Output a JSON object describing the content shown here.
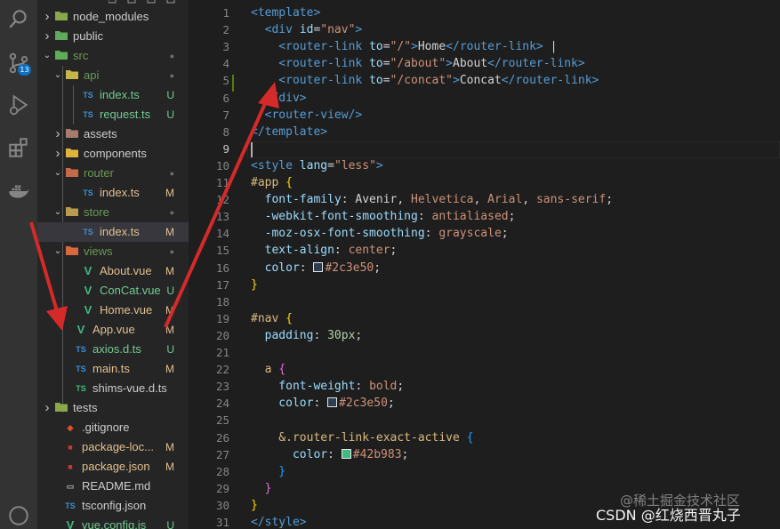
{
  "activity_bar": {
    "items": [
      {
        "name": "search-icon"
      },
      {
        "name": "source-control-icon",
        "badge": "13"
      },
      {
        "name": "run-debug-icon"
      },
      {
        "name": "extensions-icon"
      },
      {
        "name": "docker-icon"
      }
    ]
  },
  "explorer": {
    "items": [
      {
        "label": "node_modules",
        "status": ""
      },
      {
        "label": "public",
        "status": ""
      },
      {
        "label": "src",
        "status": "●"
      },
      {
        "label": "api",
        "status": "●"
      },
      {
        "label": "index.ts",
        "status": "U"
      },
      {
        "label": "request.ts",
        "status": "U"
      },
      {
        "label": "assets",
        "status": ""
      },
      {
        "label": "components",
        "status": ""
      },
      {
        "label": "router",
        "status": "●"
      },
      {
        "label": "index.ts",
        "status": "M"
      },
      {
        "label": "store",
        "status": "●"
      },
      {
        "label": "index.ts",
        "status": "M"
      },
      {
        "label": "views",
        "status": "●"
      },
      {
        "label": "About.vue",
        "status": "M"
      },
      {
        "label": "ConCat.vue",
        "status": "U"
      },
      {
        "label": "Home.vue",
        "status": "M"
      },
      {
        "label": "App.vue",
        "status": "M"
      },
      {
        "label": "axios.d.ts",
        "status": "U"
      },
      {
        "label": "main.ts",
        "status": "M"
      },
      {
        "label": "shims-vue.d.ts",
        "status": ""
      },
      {
        "label": "tests",
        "status": ""
      },
      {
        "label": ".gitignore",
        "status": ""
      },
      {
        "label": "package-loc...",
        "status": "M"
      },
      {
        "label": "package.json",
        "status": "M"
      },
      {
        "label": "README.md",
        "status": ""
      },
      {
        "label": "tsconfig.json",
        "status": ""
      },
      {
        "label": "vue.config.js",
        "status": "U"
      }
    ]
  },
  "editor": {
    "line_numbers": [
      "1",
      "2",
      "3",
      "4",
      "5",
      "6",
      "7",
      "8",
      "9",
      "10",
      "11",
      "12",
      "13",
      "14",
      "15",
      "16",
      "17",
      "18",
      "19",
      "20",
      "21",
      "22",
      "23",
      "24",
      "25",
      "26",
      "27",
      "28",
      "29",
      "30",
      "31"
    ],
    "current_line": "9",
    "lines": [
      [
        [
          "<template>",
          "#569cd6"
        ]
      ],
      [
        [
          "  <div ",
          "#569cd6"
        ],
        [
          "id",
          "#9cdcfe"
        ],
        [
          "=",
          "#d4d4d4"
        ],
        [
          "\"nav\"",
          "#ce9178"
        ],
        [
          ">",
          "#569cd6"
        ]
      ],
      [
        [
          "    <router-link ",
          "#569cd6"
        ],
        [
          "to",
          "#9cdcfe"
        ],
        [
          "=",
          "#d4d4d4"
        ],
        [
          "\"/\"",
          "#ce9178"
        ],
        [
          ">",
          "#569cd6"
        ],
        [
          "Home",
          "#d4d4d4"
        ],
        [
          "</router-link>",
          "#569cd6"
        ],
        [
          " |",
          "#d4d4d4"
        ]
      ],
      [
        [
          "    <router-link ",
          "#569cd6"
        ],
        [
          "to",
          "#9cdcfe"
        ],
        [
          "=",
          "#d4d4d4"
        ],
        [
          "\"/about\"",
          "#ce9178"
        ],
        [
          ">",
          "#569cd6"
        ],
        [
          "About",
          "#d4d4d4"
        ],
        [
          "</router-link>",
          "#569cd6"
        ]
      ],
      [
        [
          "    <router-link ",
          "#569cd6"
        ],
        [
          "to",
          "#9cdcfe"
        ],
        [
          "=",
          "#d4d4d4"
        ],
        [
          "\"/concat\"",
          "#ce9178"
        ],
        [
          ">",
          "#569cd6"
        ],
        [
          "Concat",
          "#d4d4d4"
        ],
        [
          "</router-link>",
          "#569cd6"
        ]
      ],
      [
        [
          "  </div>",
          "#569cd6"
        ]
      ],
      [
        [
          "  <router-view/>",
          "#569cd6"
        ]
      ],
      [
        [
          "</template>",
          "#569cd6"
        ]
      ],
      [
        [
          "",
          "#d4d4d4"
        ]
      ],
      [
        [
          "<style ",
          "#569cd6"
        ],
        [
          "lang",
          "#9cdcfe"
        ],
        [
          "=",
          "#d4d4d4"
        ],
        [
          "\"less\"",
          "#ce9178"
        ],
        [
          ">",
          "#569cd6"
        ]
      ],
      [
        [
          "#app ",
          "#d7ba7d"
        ],
        [
          "{",
          "#ffd700"
        ]
      ],
      [
        [
          "  font-family",
          "#9cdcfe"
        ],
        [
          ": Avenir, ",
          "#d4d4d4"
        ],
        [
          "Helvetica",
          "#ce9178"
        ],
        [
          ", ",
          "#d4d4d4"
        ],
        [
          "Arial",
          "#ce9178"
        ],
        [
          ", ",
          "#d4d4d4"
        ],
        [
          "sans-serif",
          "#ce9178"
        ],
        [
          ";",
          "#d4d4d4"
        ]
      ],
      [
        [
          "  -webkit-font-smoothing",
          "#9cdcfe"
        ],
        [
          ": ",
          "#d4d4d4"
        ],
        [
          "antialiased",
          "#ce9178"
        ],
        [
          ";",
          "#d4d4d4"
        ]
      ],
      [
        [
          "  -moz-osx-font-smoothing",
          "#9cdcfe"
        ],
        [
          ": ",
          "#d4d4d4"
        ],
        [
          "grayscale",
          "#ce9178"
        ],
        [
          ";",
          "#d4d4d4"
        ]
      ],
      [
        [
          "  text-align",
          "#9cdcfe"
        ],
        [
          ": ",
          "#d4d4d4"
        ],
        [
          "center",
          "#ce9178"
        ],
        [
          ";",
          "#d4d4d4"
        ]
      ],
      [
        [
          "  color",
          "#9cdcfe"
        ],
        [
          ": ",
          "#d4d4d4"
        ],
        [
          "SW:#2c3e50",
          "#2c3e50"
        ],
        [
          "#2c3e50",
          "#ce9178"
        ],
        [
          ";",
          "#d4d4d4"
        ]
      ],
      [
        [
          "}",
          "#ffd700"
        ]
      ],
      [
        [
          "",
          "#d4d4d4"
        ]
      ],
      [
        [
          "#nav ",
          "#d7ba7d"
        ],
        [
          "{",
          "#ffd700"
        ]
      ],
      [
        [
          "  padding",
          "#9cdcfe"
        ],
        [
          ": ",
          "#d4d4d4"
        ],
        [
          "30px",
          "#b5cea8"
        ],
        [
          ";",
          "#d4d4d4"
        ]
      ],
      [
        [
          "",
          "#d4d4d4"
        ]
      ],
      [
        [
          "  a ",
          "#d7ba7d"
        ],
        [
          "{",
          "#da70d6"
        ]
      ],
      [
        [
          "    font-weight",
          "#9cdcfe"
        ],
        [
          ": ",
          "#d4d4d4"
        ],
        [
          "bold",
          "#ce9178"
        ],
        [
          ";",
          "#d4d4d4"
        ]
      ],
      [
        [
          "    color",
          "#9cdcfe"
        ],
        [
          ": ",
          "#d4d4d4"
        ],
        [
          "SW:#2c3e50",
          "#2c3e50"
        ],
        [
          "#2c3e50",
          "#ce9178"
        ],
        [
          ";",
          "#d4d4d4"
        ]
      ],
      [
        [
          "",
          "#d4d4d4"
        ]
      ],
      [
        [
          "    &.router-link-exact-active ",
          "#d7ba7d"
        ],
        [
          "{",
          "#179fff"
        ]
      ],
      [
        [
          "      color",
          "#9cdcfe"
        ],
        [
          ": ",
          "#d4d4d4"
        ],
        [
          "SW:#42b983",
          "#42b983"
        ],
        [
          "#42b983",
          "#ce9178"
        ],
        [
          ";",
          "#d4d4d4"
        ]
      ],
      [
        [
          "    }",
          "#179fff"
        ]
      ],
      [
        [
          "  }",
          "#da70d6"
        ]
      ],
      [
        [
          "}",
          "#ffd700"
        ]
      ],
      [
        [
          "</style>",
          "#569cd6"
        ]
      ]
    ]
  },
  "watermark": {
    "primary": "@稀土掘金技术社区",
    "secondary": "CSDN @红烧西晋丸子"
  }
}
